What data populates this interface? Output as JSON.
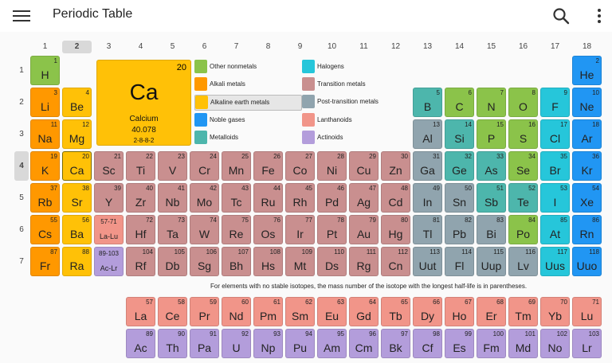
{
  "app": {
    "title": "Periodic Table"
  },
  "colors": {
    "alkali": "#ff9800",
    "alkaline": "#ffc107",
    "transition": "#c98f8f",
    "post": "#90a4ae",
    "metalloid": "#4db6ac",
    "nonmetal": "#8bc34a",
    "halogen": "#26c6da",
    "noble": "#2196f3",
    "lanthanoid": "#f19589",
    "actinoid": "#b39ddb"
  },
  "groups": [
    "1",
    "2",
    "3",
    "4",
    "5",
    "6",
    "7",
    "8",
    "9",
    "10",
    "11",
    "12",
    "13",
    "14",
    "15",
    "16",
    "17",
    "18"
  ],
  "periods": [
    "1",
    "2",
    "3",
    "4",
    "5",
    "6",
    "7"
  ],
  "selected_group": "2",
  "selected_period": "4",
  "selected_element": {
    "number": "20",
    "symbol": "Ca",
    "name": "Calcium",
    "mass": "40.078",
    "config": "2-8-8-2"
  },
  "legend": [
    {
      "label": "Other nonmetals",
      "cat": "nonmetal"
    },
    {
      "label": "Alkali metals",
      "cat": "alkali"
    },
    {
      "label": "Alkaline earth metals",
      "cat": "alkaline"
    },
    {
      "label": "Noble gases",
      "cat": "noble"
    },
    {
      "label": "Metalloids",
      "cat": "metalloid"
    },
    {
      "label": "Halogens",
      "cat": "halogen"
    },
    {
      "label": "Transition metals",
      "cat": "transition"
    },
    {
      "label": "Post-transition metals",
      "cat": "post"
    },
    {
      "label": "Lanthanoids",
      "cat": "lanthanoid"
    },
    {
      "label": "Actinoids",
      "cat": "actinoid"
    }
  ],
  "note": "For elements with no stable isotopes, the mass number of the isotope with the longest half-life is in parentheses.",
  "elements": [
    {
      "n": "1",
      "s": "H",
      "g": 1,
      "p": 1,
      "c": "nonmetal"
    },
    {
      "n": "2",
      "s": "He",
      "g": 18,
      "p": 1,
      "c": "noble"
    },
    {
      "n": "3",
      "s": "Li",
      "g": 1,
      "p": 2,
      "c": "alkali"
    },
    {
      "n": "4",
      "s": "Be",
      "g": 2,
      "p": 2,
      "c": "alkaline"
    },
    {
      "n": "5",
      "s": "B",
      "g": 13,
      "p": 2,
      "c": "metalloid"
    },
    {
      "n": "6",
      "s": "C",
      "g": 14,
      "p": 2,
      "c": "nonmetal"
    },
    {
      "n": "7",
      "s": "N",
      "g": 15,
      "p": 2,
      "c": "nonmetal"
    },
    {
      "n": "8",
      "s": "O",
      "g": 16,
      "p": 2,
      "c": "nonmetal"
    },
    {
      "n": "9",
      "s": "F",
      "g": 17,
      "p": 2,
      "c": "halogen"
    },
    {
      "n": "10",
      "s": "Ne",
      "g": 18,
      "p": 2,
      "c": "noble"
    },
    {
      "n": "11",
      "s": "Na",
      "g": 1,
      "p": 3,
      "c": "alkali"
    },
    {
      "n": "12",
      "s": "Mg",
      "g": 2,
      "p": 3,
      "c": "alkaline"
    },
    {
      "n": "13",
      "s": "Al",
      "g": 13,
      "p": 3,
      "c": "post"
    },
    {
      "n": "14",
      "s": "Si",
      "g": 14,
      "p": 3,
      "c": "metalloid"
    },
    {
      "n": "15",
      "s": "P",
      "g": 15,
      "p": 3,
      "c": "nonmetal"
    },
    {
      "n": "16",
      "s": "S",
      "g": 16,
      "p": 3,
      "c": "nonmetal"
    },
    {
      "n": "17",
      "s": "Cl",
      "g": 17,
      "p": 3,
      "c": "halogen"
    },
    {
      "n": "18",
      "s": "Ar",
      "g": 18,
      "p": 3,
      "c": "noble"
    },
    {
      "n": "19",
      "s": "K",
      "g": 1,
      "p": 4,
      "c": "alkali"
    },
    {
      "n": "20",
      "s": "Ca",
      "g": 2,
      "p": 4,
      "c": "alkaline"
    },
    {
      "n": "21",
      "s": "Sc",
      "g": 3,
      "p": 4,
      "c": "transition"
    },
    {
      "n": "22",
      "s": "Ti",
      "g": 4,
      "p": 4,
      "c": "transition"
    },
    {
      "n": "23",
      "s": "V",
      "g": 5,
      "p": 4,
      "c": "transition"
    },
    {
      "n": "24",
      "s": "Cr",
      "g": 6,
      "p": 4,
      "c": "transition"
    },
    {
      "n": "25",
      "s": "Mn",
      "g": 7,
      "p": 4,
      "c": "transition"
    },
    {
      "n": "26",
      "s": "Fe",
      "g": 8,
      "p": 4,
      "c": "transition"
    },
    {
      "n": "27",
      "s": "Co",
      "g": 9,
      "p": 4,
      "c": "transition"
    },
    {
      "n": "28",
      "s": "Ni",
      "g": 10,
      "p": 4,
      "c": "transition"
    },
    {
      "n": "29",
      "s": "Cu",
      "g": 11,
      "p": 4,
      "c": "transition"
    },
    {
      "n": "30",
      "s": "Zn",
      "g": 12,
      "p": 4,
      "c": "transition"
    },
    {
      "n": "31",
      "s": "Ga",
      "g": 13,
      "p": 4,
      "c": "post"
    },
    {
      "n": "32",
      "s": "Ge",
      "g": 14,
      "p": 4,
      "c": "metalloid"
    },
    {
      "n": "33",
      "s": "As",
      "g": 15,
      "p": 4,
      "c": "metalloid"
    },
    {
      "n": "34",
      "s": "Se",
      "g": 16,
      "p": 4,
      "c": "nonmetal"
    },
    {
      "n": "35",
      "s": "Br",
      "g": 17,
      "p": 4,
      "c": "halogen"
    },
    {
      "n": "36",
      "s": "Kr",
      "g": 18,
      "p": 4,
      "c": "noble"
    },
    {
      "n": "37",
      "s": "Rb",
      "g": 1,
      "p": 5,
      "c": "alkali"
    },
    {
      "n": "38",
      "s": "Sr",
      "g": 2,
      "p": 5,
      "c": "alkaline"
    },
    {
      "n": "39",
      "s": "Y",
      "g": 3,
      "p": 5,
      "c": "transition"
    },
    {
      "n": "40",
      "s": "Zr",
      "g": 4,
      "p": 5,
      "c": "transition"
    },
    {
      "n": "41",
      "s": "Nb",
      "g": 5,
      "p": 5,
      "c": "transition"
    },
    {
      "n": "42",
      "s": "Mo",
      "g": 6,
      "p": 5,
      "c": "transition"
    },
    {
      "n": "43",
      "s": "Tc",
      "g": 7,
      "p": 5,
      "c": "transition"
    },
    {
      "n": "44",
      "s": "Ru",
      "g": 8,
      "p": 5,
      "c": "transition"
    },
    {
      "n": "45",
      "s": "Rh",
      "g": 9,
      "p": 5,
      "c": "transition"
    },
    {
      "n": "46",
      "s": "Pd",
      "g": 10,
      "p": 5,
      "c": "transition"
    },
    {
      "n": "47",
      "s": "Ag",
      "g": 11,
      "p": 5,
      "c": "transition"
    },
    {
      "n": "48",
      "s": "Cd",
      "g": 12,
      "p": 5,
      "c": "transition"
    },
    {
      "n": "49",
      "s": "In",
      "g": 13,
      "p": 5,
      "c": "post"
    },
    {
      "n": "50",
      "s": "Sn",
      "g": 14,
      "p": 5,
      "c": "post"
    },
    {
      "n": "51",
      "s": "Sb",
      "g": 15,
      "p": 5,
      "c": "metalloid"
    },
    {
      "n": "52",
      "s": "Te",
      "g": 16,
      "p": 5,
      "c": "metalloid"
    },
    {
      "n": "53",
      "s": "I",
      "g": 17,
      "p": 5,
      "c": "halogen"
    },
    {
      "n": "54",
      "s": "Xe",
      "g": 18,
      "p": 5,
      "c": "noble"
    },
    {
      "n": "55",
      "s": "Cs",
      "g": 1,
      "p": 6,
      "c": "alkali"
    },
    {
      "n": "56",
      "s": "Ba",
      "g": 2,
      "p": 6,
      "c": "alkaline"
    },
    {
      "n": "57-71",
      "s": "La-Lu",
      "g": 3,
      "p": 6,
      "c": "lanthanoid",
      "ph": true
    },
    {
      "n": "72",
      "s": "Hf",
      "g": 4,
      "p": 6,
      "c": "transition"
    },
    {
      "n": "73",
      "s": "Ta",
      "g": 5,
      "p": 6,
      "c": "transition"
    },
    {
      "n": "74",
      "s": "W",
      "g": 6,
      "p": 6,
      "c": "transition"
    },
    {
      "n": "75",
      "s": "Re",
      "g": 7,
      "p": 6,
      "c": "transition"
    },
    {
      "n": "76",
      "s": "Os",
      "g": 8,
      "p": 6,
      "c": "transition"
    },
    {
      "n": "77",
      "s": "Ir",
      "g": 9,
      "p": 6,
      "c": "transition"
    },
    {
      "n": "78",
      "s": "Pt",
      "g": 10,
      "p": 6,
      "c": "transition"
    },
    {
      "n": "79",
      "s": "Au",
      "g": 11,
      "p": 6,
      "c": "transition"
    },
    {
      "n": "80",
      "s": "Hg",
      "g": 12,
      "p": 6,
      "c": "transition"
    },
    {
      "n": "81",
      "s": "Tl",
      "g": 13,
      "p": 6,
      "c": "post"
    },
    {
      "n": "82",
      "s": "Pb",
      "g": 14,
      "p": 6,
      "c": "post"
    },
    {
      "n": "83",
      "s": "Bi",
      "g": 15,
      "p": 6,
      "c": "post"
    },
    {
      "n": "84",
      "s": "Po",
      "g": 16,
      "p": 6,
      "c": "nonmetal"
    },
    {
      "n": "85",
      "s": "At",
      "g": 17,
      "p": 6,
      "c": "halogen"
    },
    {
      "n": "86",
      "s": "Rn",
      "g": 18,
      "p": 6,
      "c": "noble"
    },
    {
      "n": "87",
      "s": "Fr",
      "g": 1,
      "p": 7,
      "c": "alkali"
    },
    {
      "n": "88",
      "s": "Ra",
      "g": 2,
      "p": 7,
      "c": "alkaline"
    },
    {
      "n": "89-103",
      "s": "Ac-Lr",
      "g": 3,
      "p": 7,
      "c": "actinoid",
      "ph": true
    },
    {
      "n": "104",
      "s": "Rf",
      "g": 4,
      "p": 7,
      "c": "transition"
    },
    {
      "n": "105",
      "s": "Db",
      "g": 5,
      "p": 7,
      "c": "transition"
    },
    {
      "n": "106",
      "s": "Sg",
      "g": 6,
      "p": 7,
      "c": "transition"
    },
    {
      "n": "107",
      "s": "Bh",
      "g": 7,
      "p": 7,
      "c": "transition"
    },
    {
      "n": "108",
      "s": "Hs",
      "g": 8,
      "p": 7,
      "c": "transition"
    },
    {
      "n": "109",
      "s": "Mt",
      "g": 9,
      "p": 7,
      "c": "transition"
    },
    {
      "n": "110",
      "s": "Ds",
      "g": 10,
      "p": 7,
      "c": "transition"
    },
    {
      "n": "111",
      "s": "Rg",
      "g": 11,
      "p": 7,
      "c": "transition"
    },
    {
      "n": "112",
      "s": "Cn",
      "g": 12,
      "p": 7,
      "c": "transition"
    },
    {
      "n": "113",
      "s": "Uut",
      "g": 13,
      "p": 7,
      "c": "post"
    },
    {
      "n": "114",
      "s": "Fl",
      "g": 14,
      "p": 7,
      "c": "post"
    },
    {
      "n": "115",
      "s": "Uup",
      "g": 15,
      "p": 7,
      "c": "post"
    },
    {
      "n": "116",
      "s": "Lv",
      "g": 16,
      "p": 7,
      "c": "post"
    },
    {
      "n": "117",
      "s": "Uus",
      "g": 17,
      "p": 7,
      "c": "halogen"
    },
    {
      "n": "118",
      "s": "Uuo",
      "g": 18,
      "p": 7,
      "c": "noble"
    },
    {
      "n": "57",
      "s": "La",
      "g": 4,
      "p": 8,
      "c": "lanthanoid"
    },
    {
      "n": "58",
      "s": "Ce",
      "g": 5,
      "p": 8,
      "c": "lanthanoid"
    },
    {
      "n": "59",
      "s": "Pr",
      "g": 6,
      "p": 8,
      "c": "lanthanoid"
    },
    {
      "n": "60",
      "s": "Nd",
      "g": 7,
      "p": 8,
      "c": "lanthanoid"
    },
    {
      "n": "61",
      "s": "Pm",
      "g": 8,
      "p": 8,
      "c": "lanthanoid"
    },
    {
      "n": "62",
      "s": "Sm",
      "g": 9,
      "p": 8,
      "c": "lanthanoid"
    },
    {
      "n": "63",
      "s": "Eu",
      "g": 10,
      "p": 8,
      "c": "lanthanoid"
    },
    {
      "n": "64",
      "s": "Gd",
      "g": 11,
      "p": 8,
      "c": "lanthanoid"
    },
    {
      "n": "65",
      "s": "Tb",
      "g": 12,
      "p": 8,
      "c": "lanthanoid"
    },
    {
      "n": "66",
      "s": "Dy",
      "g": 13,
      "p": 8,
      "c": "lanthanoid"
    },
    {
      "n": "67",
      "s": "Ho",
      "g": 14,
      "p": 8,
      "c": "lanthanoid"
    },
    {
      "n": "68",
      "s": "Er",
      "g": 15,
      "p": 8,
      "c": "lanthanoid"
    },
    {
      "n": "69",
      "s": "Tm",
      "g": 16,
      "p": 8,
      "c": "lanthanoid"
    },
    {
      "n": "70",
      "s": "Yb",
      "g": 17,
      "p": 8,
      "c": "lanthanoid"
    },
    {
      "n": "71",
      "s": "Lu",
      "g": 18,
      "p": 8,
      "c": "lanthanoid"
    },
    {
      "n": "89",
      "s": "Ac",
      "g": 4,
      "p": 9,
      "c": "actinoid"
    },
    {
      "n": "90",
      "s": "Th",
      "g": 5,
      "p": 9,
      "c": "actinoid"
    },
    {
      "n": "91",
      "s": "Pa",
      "g": 6,
      "p": 9,
      "c": "actinoid"
    },
    {
      "n": "92",
      "s": "U",
      "g": 7,
      "p": 9,
      "c": "actinoid"
    },
    {
      "n": "93",
      "s": "Np",
      "g": 8,
      "p": 9,
      "c": "actinoid"
    },
    {
      "n": "94",
      "s": "Pu",
      "g": 9,
      "p": 9,
      "c": "actinoid"
    },
    {
      "n": "95",
      "s": "Am",
      "g": 10,
      "p": 9,
      "c": "actinoid"
    },
    {
      "n": "96",
      "s": "Cm",
      "g": 11,
      "p": 9,
      "c": "actinoid"
    },
    {
      "n": "97",
      "s": "Bk",
      "g": 12,
      "p": 9,
      "c": "actinoid"
    },
    {
      "n": "98",
      "s": "Cf",
      "g": 13,
      "p": 9,
      "c": "actinoid"
    },
    {
      "n": "99",
      "s": "Es",
      "g": 14,
      "p": 9,
      "c": "actinoid"
    },
    {
      "n": "100",
      "s": "Fm",
      "g": 15,
      "p": 9,
      "c": "actinoid"
    },
    {
      "n": "101",
      "s": "Md",
      "g": 16,
      "p": 9,
      "c": "actinoid"
    },
    {
      "n": "102",
      "s": "No",
      "g": 17,
      "p": 9,
      "c": "actinoid"
    },
    {
      "n": "103",
      "s": "Lr",
      "g": 18,
      "p": 9,
      "c": "actinoid"
    }
  ]
}
